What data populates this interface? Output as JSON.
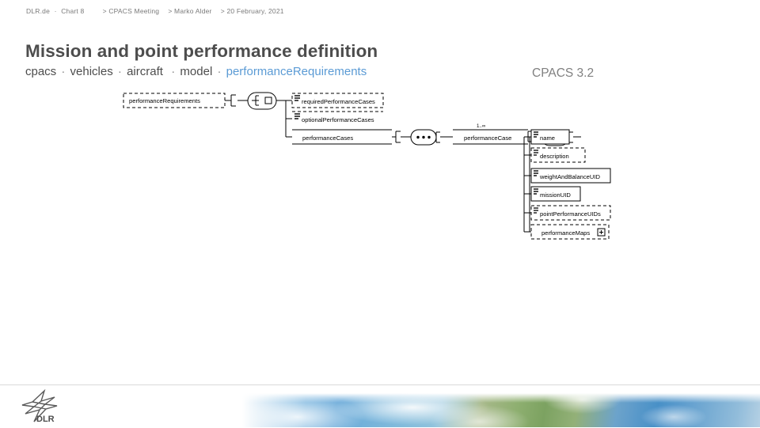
{
  "header": {
    "site": "DLR.de",
    "chart": "Chart 8",
    "meeting": "> CPACS Meeting",
    "author": "> Marko Alder",
    "date": "> 20 February, 2021"
  },
  "slide": {
    "title": "Mission and point performance definition",
    "breadcrumb_path": [
      "cpacs",
      "vehicles",
      "aircraft",
      "model",
      "performanceRequirements"
    ],
    "accent_color": "#5b9bd5",
    "version": "CPACS 3.2"
  },
  "diagram": {
    "type": "xsd-schema-tree",
    "root": "performanceRequirements",
    "choice_symbol": "choice",
    "sequence_symbol": "sequence",
    "ellipsis_symbol": "...",
    "cardinality": "1..∞",
    "expand_symbol": "+",
    "nodes": [
      {
        "label": "requiredPerformanceCases",
        "style": "optional"
      },
      {
        "label": "optionalPerformanceCases",
        "style": "optional"
      },
      {
        "label": "performanceCases",
        "style": "required"
      },
      {
        "label": "performanceCase",
        "style": "required"
      },
      {
        "label": "name",
        "style": "required"
      },
      {
        "label": "description",
        "style": "optional"
      },
      {
        "label": "weightAndBalanceUID",
        "style": "required"
      },
      {
        "label": "missionUID",
        "style": "required"
      },
      {
        "label": "pointPerformanceUIDs",
        "style": "optional"
      },
      {
        "label": "performanceMaps",
        "style": "optional"
      }
    ]
  },
  "footer": {
    "logo_text": "DLR",
    "logo_name": "dlr-logo",
    "background_name": "earth-imagery-strip"
  }
}
